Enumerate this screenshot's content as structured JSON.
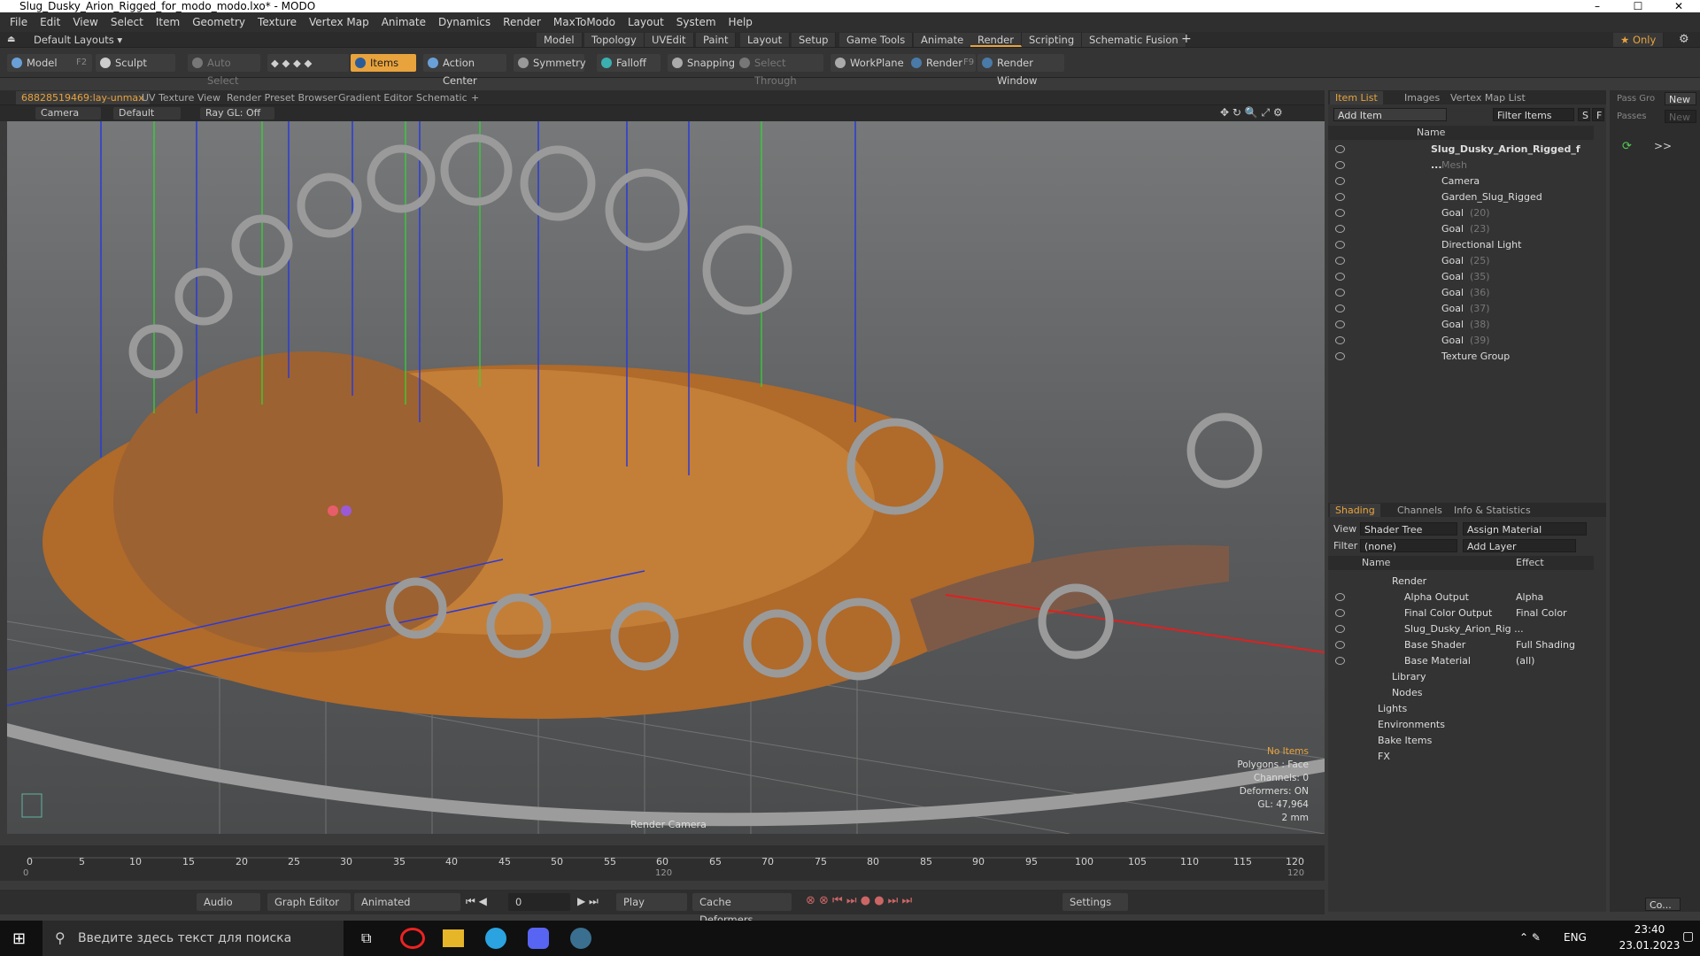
{
  "window": {
    "title": "Slug_Dusky_Arion_Rigged_for_modo_modo.lxo* - MODO"
  },
  "menu": [
    "File",
    "Edit",
    "View",
    "Select",
    "Item",
    "Geometry",
    "Texture",
    "Vertex Map",
    "Animate",
    "Dynamics",
    "Render",
    "MaxToModo",
    "Layout",
    "System",
    "Help"
  ],
  "layout": {
    "default_label": "Default Layouts ▾",
    "tabs": [
      "Model",
      "Topology",
      "UVEdit",
      "Paint",
      "Layout",
      "Setup",
      "Game Tools",
      "Animate",
      "Render",
      "Scripting",
      "Schematic Fusion"
    ],
    "active": "Render",
    "only": "★ Only"
  },
  "toolbar": {
    "model": "Model",
    "model_key": "F2",
    "sculpt": "Sculpt",
    "auto_select": "Auto Select",
    "items": "Items",
    "action_center": "Action Center",
    "symmetry": "Symmetry",
    "falloff": "Falloff",
    "snapping": "Snapping",
    "select_through": "Select Through",
    "workplane": "WorkPlane",
    "render": "Render",
    "render_key": "F9",
    "render_window": "Render Window"
  },
  "viewport_tabs": [
    "68828519469:lay-unmax",
    "UV Texture View",
    "Render Preset Browser",
    "Gradient Editor",
    "Schematic"
  ],
  "viewport_bar": {
    "camera": "Camera",
    "default": "Default",
    "raygl": "Ray GL: Off"
  },
  "stats": {
    "no_items": "No Items",
    "polygons": "Polygons : Face",
    "channels": "Channels: 0",
    "deformers": "Deformers: ON",
    "gl": "GL: 47,964",
    "scale": "2 mm"
  },
  "render_camera": "Render Camera",
  "timeline": {
    "ticks": [
      "0",
      "5",
      "10",
      "15",
      "20",
      "25",
      "30",
      "35",
      "40",
      "45",
      "50",
      "55",
      "60",
      "65",
      "70",
      "75",
      "80",
      "85",
      "90",
      "95",
      "100",
      "105",
      "110",
      "115",
      "120"
    ],
    "sub_left": "0",
    "sub_mid": "120",
    "sub_right": "120"
  },
  "transport": {
    "audio": "Audio",
    "graph": "Graph Editor",
    "animated": "Animated",
    "frame": "0",
    "play": "Play",
    "cache": "Cache Deformers",
    "settings": "Settings"
  },
  "item_list": {
    "tabs": [
      "Item List",
      "Images",
      "Vertex Map List"
    ],
    "add_item": "Add Item",
    "filter": "Filter Items",
    "s": "S",
    "f": "F",
    "col_name": "Name",
    "items": [
      {
        "name": "Slug_Dusky_Arion_Rigged_f ...",
        "sub": "",
        "indent": 0,
        "bold": true
      },
      {
        "name": "Mesh",
        "sub": "",
        "indent": 1,
        "dim": true
      },
      {
        "name": "Camera",
        "sub": "",
        "indent": 1
      },
      {
        "name": "Garden_Slug_Rigged",
        "sub": "",
        "indent": 1
      },
      {
        "name": "Goal",
        "sub": "(20)",
        "indent": 1
      },
      {
        "name": "Goal",
        "sub": "(23)",
        "indent": 1
      },
      {
        "name": "Directional Light",
        "sub": "",
        "indent": 1
      },
      {
        "name": "Goal",
        "sub": "(25)",
        "indent": 1
      },
      {
        "name": "Goal",
        "sub": "(35)",
        "indent": 1
      },
      {
        "name": "Goal",
        "sub": "(36)",
        "indent": 1
      },
      {
        "name": "Goal",
        "sub": "(37)",
        "indent": 1
      },
      {
        "name": "Goal",
        "sub": "(38)",
        "indent": 1
      },
      {
        "name": "Goal",
        "sub": "(39)",
        "indent": 1
      },
      {
        "name": "Texture Group",
        "sub": "",
        "indent": 1
      }
    ]
  },
  "shading": {
    "tabs": [
      "Shading",
      "Channels",
      "Info & Statistics"
    ],
    "view_label": "View",
    "view_value": "Shader Tree",
    "assign": "Assign Material",
    "filter_label": "Filter",
    "filter_value": "(none)",
    "add_layer": "Add Layer",
    "col_name": "Name",
    "col_effect": "Effect",
    "rows": [
      {
        "name": "Render",
        "effect": "",
        "indent": 0
      },
      {
        "name": "Alpha Output",
        "effect": "Alpha",
        "indent": 1
      },
      {
        "name": "Final Color Output",
        "effect": "Final Color",
        "indent": 1
      },
      {
        "name": "Slug_Dusky_Arion_Rig ...",
        "effect": "",
        "indent": 1
      },
      {
        "name": "Base Shader",
        "effect": "Full Shading",
        "indent": 1
      },
      {
        "name": "Base Material",
        "effect": "(all)",
        "indent": 1
      },
      {
        "name": "Library",
        "effect": "",
        "indent": 1
      },
      {
        "name": "Nodes",
        "effect": "",
        "indent": 1
      },
      {
        "name": "Lights",
        "effect": "",
        "indent": 0
      },
      {
        "name": "Environments",
        "effect": "",
        "indent": 0
      },
      {
        "name": "Bake Items",
        "effect": "",
        "indent": 0
      },
      {
        "name": "FX",
        "effect": "",
        "indent": 0
      }
    ]
  },
  "pass": {
    "pass_group": "Pass Gro",
    "passes": "Passes",
    "new1": "New",
    "new2": "New",
    "co": "Co..."
  },
  "taskbar": {
    "search": "Введите здесь текст для поиска",
    "lang": "ENG",
    "time": "23:40",
    "date": "23.01.2023"
  }
}
